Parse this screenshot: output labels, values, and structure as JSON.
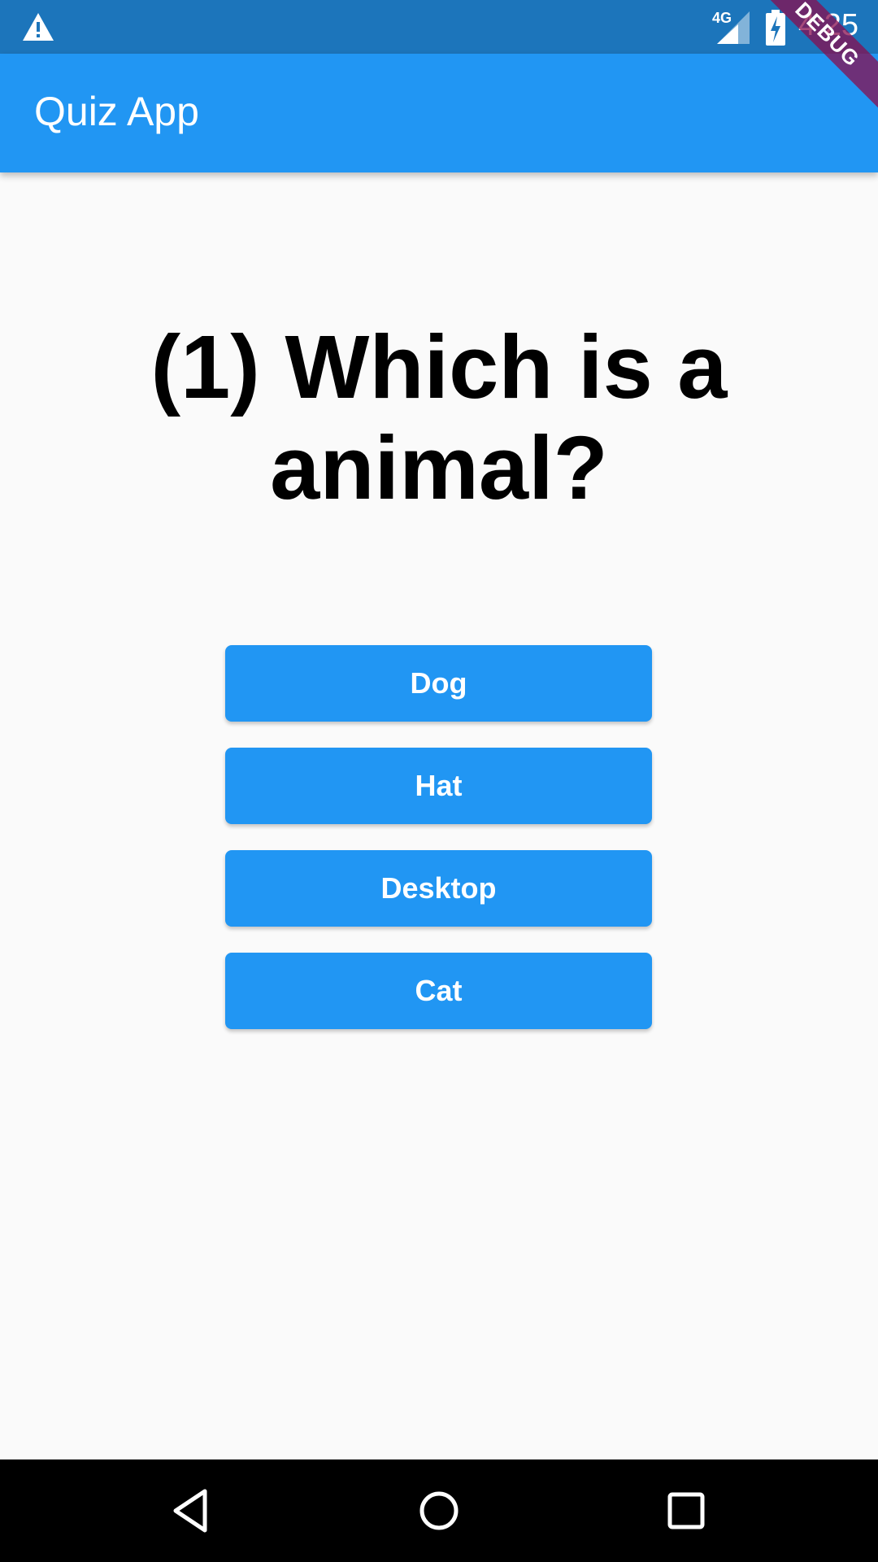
{
  "status_bar": {
    "time": "4:25",
    "network_label": "4G",
    "icons": [
      "warning-icon",
      "signal-icon",
      "battery-charging-icon"
    ]
  },
  "debug_banner": {
    "label": "DEBUG"
  },
  "app_bar": {
    "title": "Quiz App"
  },
  "quiz": {
    "question": "(1) Which is a animal?",
    "answers": [
      {
        "label": "Dog"
      },
      {
        "label": "Hat"
      },
      {
        "label": "Desktop"
      },
      {
        "label": "Cat"
      }
    ]
  },
  "nav_bar": {
    "icons": [
      "back-icon",
      "home-icon",
      "recents-icon"
    ]
  },
  "colors": {
    "status_bar": "#1c75bb",
    "primary": "#2196f3",
    "background": "#fafafa",
    "nav_bar": "#000000",
    "debug_ribbon": "#880e4f"
  }
}
